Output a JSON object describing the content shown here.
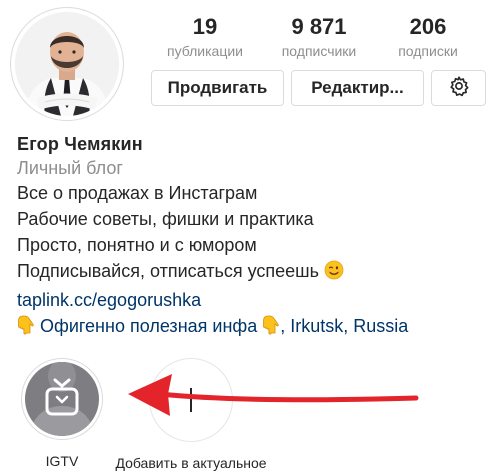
{
  "profile": {
    "name": "Егор Чемякин",
    "category": "Личный блог",
    "bio_lines": [
      "Все о продажах в Инстаграм",
      "Рабочие советы, фишки и практика",
      "Просто, понятно и с юмором",
      "Подписывайся, отписаться успеешь"
    ],
    "bio_line4_emoji": "winking-face-emoji",
    "link": "taplink.cc/egogorushka",
    "promo_text": "Офигенно полезная инфа",
    "location": ", Irkutsk, Russia",
    "promo_emoji": "pointing-down-hand-emoji"
  },
  "stats": {
    "posts_value": "19",
    "posts_label": "публикации",
    "followers_value": "9 871",
    "followers_label": "подписчики",
    "following_value": "206",
    "following_label": "подписки"
  },
  "buttons": {
    "promote_label": "Продвигать",
    "edit_label": "Редактир...",
    "settings_icon": "gear-icon"
  },
  "highlights": [
    {
      "label": "IGTV",
      "icon": "igtv-icon"
    },
    {
      "label": "Добавить в актуальное",
      "icon": "plus-icon"
    }
  ],
  "colors": {
    "text": "#262626",
    "secondary_text": "#8e8e8e",
    "link": "#003569",
    "border": "#dbdbdb",
    "annotation_arrow": "#e3242b"
  }
}
